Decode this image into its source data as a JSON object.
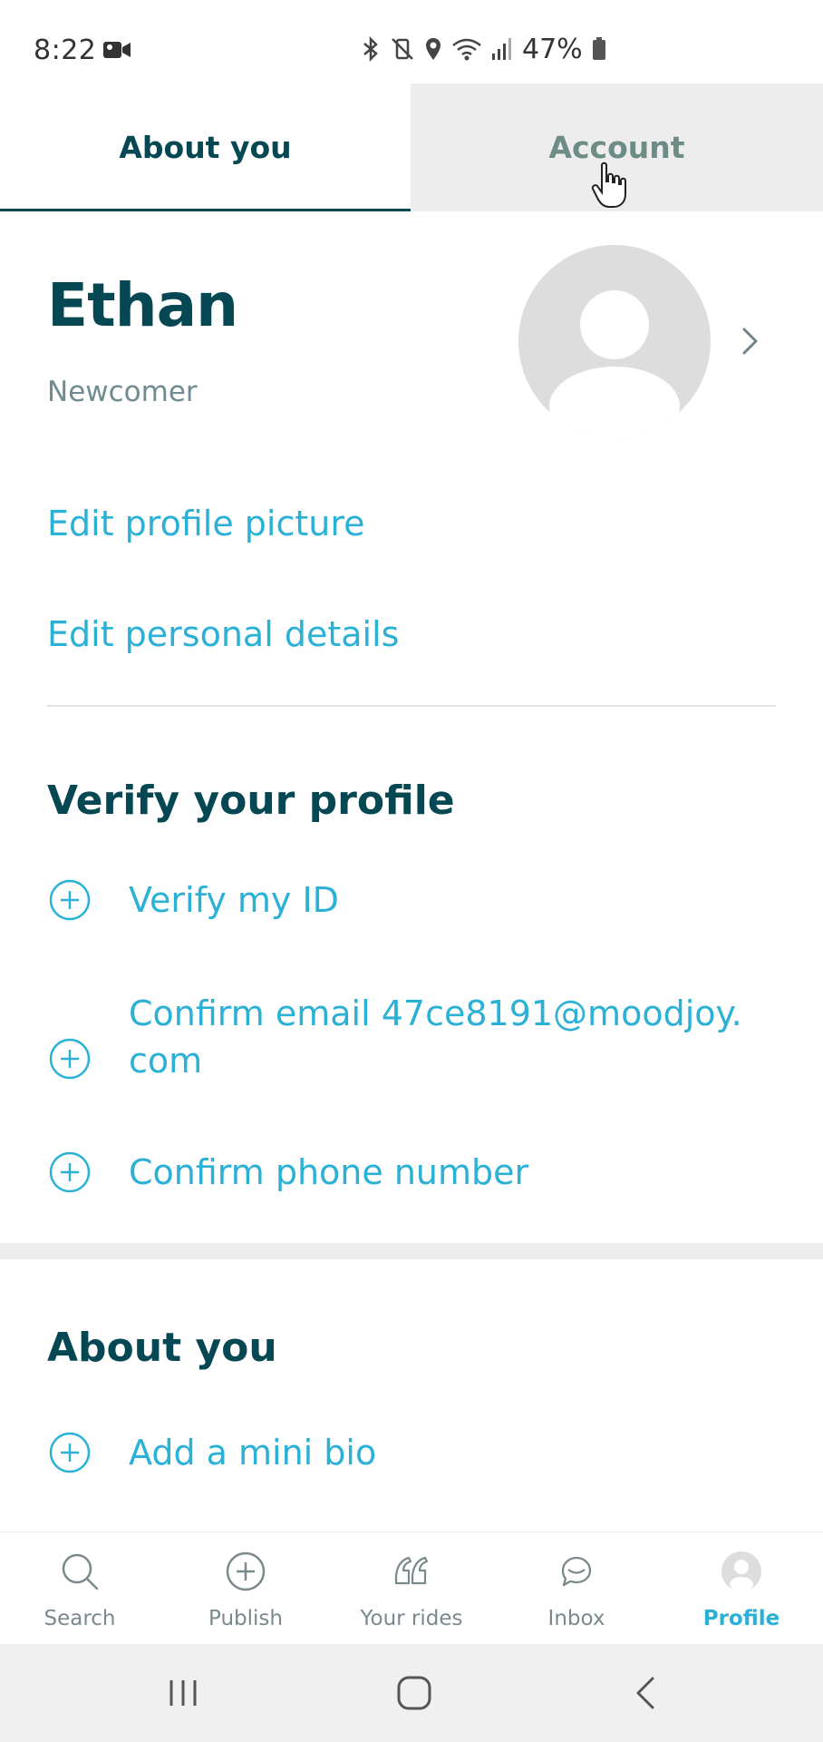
{
  "status_bar": {
    "time": "8:22",
    "battery": "47%",
    "icons": [
      "video-camera-icon",
      "bluetooth-icon",
      "vibrate-mute-icon",
      "location-icon",
      "wifi-icon",
      "signal-icon",
      "battery-icon"
    ]
  },
  "tabs": [
    {
      "label": "About you",
      "active": true
    },
    {
      "label": "Account",
      "active": false
    }
  ],
  "profile": {
    "name": "Ethan",
    "level": "Newcomer"
  },
  "links": {
    "edit_picture": "Edit profile picture",
    "edit_details": "Edit personal details"
  },
  "verify": {
    "title": "Verify your profile",
    "items": [
      {
        "label": "Verify my ID"
      },
      {
        "label": "Confirm email 47ce8191@moodjoy.com"
      },
      {
        "label": "Confirm phone number"
      }
    ]
  },
  "about": {
    "title": "About you",
    "items": [
      {
        "label": "Add a mini bio"
      }
    ]
  },
  "bottom_nav": [
    {
      "label": "Search",
      "icon": "search-icon",
      "active": false
    },
    {
      "label": "Publish",
      "icon": "plus-circle-icon",
      "active": false
    },
    {
      "label": "Your rides",
      "icon": "rides-icon",
      "active": false
    },
    {
      "label": "Inbox",
      "icon": "chat-icon",
      "active": false
    },
    {
      "label": "Profile",
      "icon": "profile-icon",
      "active": true
    }
  ],
  "colors": {
    "primary": "#054752",
    "link": "#2bb0d6",
    "muted": "#708c91",
    "tab_inactive_bg": "#ededed"
  }
}
